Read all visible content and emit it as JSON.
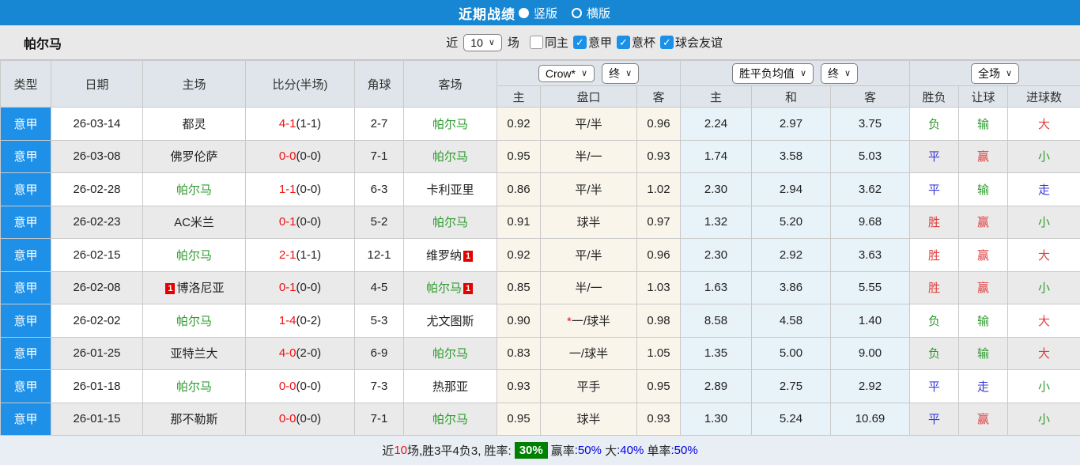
{
  "topbar": {
    "title": "近期战绩",
    "options": [
      {
        "label": "竖版",
        "selected": true
      },
      {
        "label": "横版",
        "selected": false
      }
    ]
  },
  "filterbar": {
    "team": "帕尔马",
    "recent_label": "近",
    "recent_value": "10",
    "unit_label": "场",
    "checkboxes": [
      {
        "label": "同主",
        "checked": false
      },
      {
        "label": "意甲",
        "checked": true
      },
      {
        "label": "意杯",
        "checked": true
      },
      {
        "label": "球会友谊",
        "checked": true
      }
    ]
  },
  "table": {
    "columns": [
      "类型",
      "日期",
      "主场",
      "比分(半场)",
      "角球",
      "客场"
    ],
    "odds_groups": [
      {
        "selects": [
          "Crow*",
          "终"
        ],
        "sub": [
          "主",
          "盘口",
          "客"
        ]
      },
      {
        "selects": [
          "胜平负均值",
          "终"
        ],
        "sub": [
          "主",
          "和",
          "客"
        ]
      },
      {
        "selects": [
          "全场"
        ],
        "sub": [
          "胜负",
          "让球",
          "进球数"
        ]
      }
    ],
    "rows": [
      {
        "type": "意甲",
        "date": "26-03-14",
        "home": {
          "name": "都灵"
        },
        "score": "4-1",
        "half": "(1-1)",
        "corner": "2-7",
        "away": {
          "name": "帕尔马",
          "green": true
        },
        "odds": [
          "0.92",
          "平/半",
          "0.96"
        ],
        "avg": [
          "2.24",
          "2.97",
          "3.75"
        ],
        "results": [
          {
            "t": "负",
            "c": "green"
          },
          {
            "t": "输",
            "c": "green"
          },
          {
            "t": "大",
            "c": "red"
          }
        ]
      },
      {
        "type": "意甲",
        "date": "26-03-08",
        "home": {
          "name": "佛罗伦萨"
        },
        "score": "0-0",
        "half": "(0-0)",
        "corner": "7-1",
        "away": {
          "name": "帕尔马",
          "green": true
        },
        "odds": [
          "0.95",
          "半/一",
          "0.93"
        ],
        "avg": [
          "1.74",
          "3.58",
          "5.03"
        ],
        "results": [
          {
            "t": "平",
            "c": "blue"
          },
          {
            "t": "赢",
            "c": "red"
          },
          {
            "t": "小",
            "c": "green"
          }
        ]
      },
      {
        "type": "意甲",
        "date": "26-02-28",
        "home": {
          "name": "帕尔马",
          "green": true
        },
        "score": "1-1",
        "half": "(0-0)",
        "corner": "6-3",
        "away": {
          "name": "卡利亚里"
        },
        "odds": [
          "0.86",
          "平/半",
          "1.02"
        ],
        "avg": [
          "2.30",
          "2.94",
          "3.62"
        ],
        "results": [
          {
            "t": "平",
            "c": "blue"
          },
          {
            "t": "输",
            "c": "green"
          },
          {
            "t": "走",
            "c": "blue"
          }
        ]
      },
      {
        "type": "意甲",
        "date": "26-02-23",
        "home": {
          "name": "AC米兰"
        },
        "score": "0-1",
        "half": "(0-0)",
        "corner": "5-2",
        "away": {
          "name": "帕尔马",
          "green": true
        },
        "odds": [
          "0.91",
          "球半",
          "0.97"
        ],
        "avg": [
          "1.32",
          "5.20",
          "9.68"
        ],
        "results": [
          {
            "t": "胜",
            "c": "red"
          },
          {
            "t": "赢",
            "c": "red"
          },
          {
            "t": "小",
            "c": "green"
          }
        ]
      },
      {
        "type": "意甲",
        "date": "26-02-15",
        "home": {
          "name": "帕尔马",
          "green": true
        },
        "score": "2-1",
        "half": "(1-1)",
        "corner": "12-1",
        "away": {
          "name": "维罗纳",
          "card": "1"
        },
        "odds": [
          "0.92",
          "平/半",
          "0.96"
        ],
        "avg": [
          "2.30",
          "2.92",
          "3.63"
        ],
        "results": [
          {
            "t": "胜",
            "c": "red"
          },
          {
            "t": "赢",
            "c": "red"
          },
          {
            "t": "大",
            "c": "red"
          }
        ]
      },
      {
        "type": "意甲",
        "date": "26-02-08",
        "home": {
          "name": "博洛尼亚",
          "card": "1",
          "card_pos": "before"
        },
        "score": "0-1",
        "half": "(0-0)",
        "corner": "4-5",
        "away": {
          "name": "帕尔马",
          "green": true,
          "card": "1"
        },
        "odds": [
          "0.85",
          "半/一",
          "1.03"
        ],
        "avg": [
          "1.63",
          "3.86",
          "5.55"
        ],
        "results": [
          {
            "t": "胜",
            "c": "red"
          },
          {
            "t": "赢",
            "c": "red"
          },
          {
            "t": "小",
            "c": "green"
          }
        ]
      },
      {
        "type": "意甲",
        "date": "26-02-02",
        "home": {
          "name": "帕尔马",
          "green": true
        },
        "score": "1-4",
        "half": "(0-2)",
        "corner": "5-3",
        "away": {
          "name": "尤文图斯"
        },
        "odds": [
          "0.90",
          "*一/球半",
          "0.98"
        ],
        "avg": [
          "8.58",
          "4.58",
          "1.40"
        ],
        "results": [
          {
            "t": "负",
            "c": "green"
          },
          {
            "t": "输",
            "c": "green"
          },
          {
            "t": "大",
            "c": "red"
          }
        ]
      },
      {
        "type": "意甲",
        "date": "26-01-25",
        "home": {
          "name": "亚特兰大"
        },
        "score": "4-0",
        "half": "(2-0)",
        "corner": "6-9",
        "away": {
          "name": "帕尔马",
          "green": true
        },
        "odds": [
          "0.83",
          "一/球半",
          "1.05"
        ],
        "avg": [
          "1.35",
          "5.00",
          "9.00"
        ],
        "results": [
          {
            "t": "负",
            "c": "green"
          },
          {
            "t": "输",
            "c": "green"
          },
          {
            "t": "大",
            "c": "red"
          }
        ]
      },
      {
        "type": "意甲",
        "date": "26-01-18",
        "home": {
          "name": "帕尔马",
          "green": true
        },
        "score": "0-0",
        "half": "(0-0)",
        "corner": "7-3",
        "away": {
          "name": "热那亚"
        },
        "odds": [
          "0.93",
          "平手",
          "0.95"
        ],
        "avg": [
          "2.89",
          "2.75",
          "2.92"
        ],
        "results": [
          {
            "t": "平",
            "c": "blue"
          },
          {
            "t": "走",
            "c": "blue"
          },
          {
            "t": "小",
            "c": "green"
          }
        ]
      },
      {
        "type": "意甲",
        "date": "26-01-15",
        "home": {
          "name": "那不勒斯"
        },
        "score": "0-0",
        "half": "(0-0)",
        "corner": "7-1",
        "away": {
          "name": "帕尔马",
          "green": true
        },
        "odds": [
          "0.95",
          "球半",
          "0.93"
        ],
        "avg": [
          "1.30",
          "5.24",
          "10.69"
        ],
        "results": [
          {
            "t": "平",
            "c": "blue"
          },
          {
            "t": "赢",
            "c": "red"
          },
          {
            "t": "小",
            "c": "green"
          }
        ]
      }
    ]
  },
  "footer": {
    "segments": [
      {
        "text": "近",
        "style": "plain"
      },
      {
        "text": "10",
        "style": "red"
      },
      {
        "text": "场,胜3平4负3, 胜率:",
        "style": "plain"
      },
      {
        "text": "30%",
        "style": "badge"
      },
      {
        "text": "赢率",
        "style": "plain"
      },
      {
        "text": ":50%",
        "style": "blue"
      },
      {
        "text": " 大",
        "style": "plain"
      },
      {
        "text": ":40%",
        "style": "blue"
      },
      {
        "text": " 单率",
        "style": "plain"
      },
      {
        "text": ":50%",
        "style": "blue"
      }
    ]
  },
  "colors": {
    "topbar_blue": "#1787d3",
    "accent_blue": "#1b90e8",
    "league_cell_blue": "#1e90e8",
    "team_green": "#2e9b2e",
    "score_red": "#ee1111",
    "result_red": "#e04040",
    "result_green": "#2e9b2e",
    "result_blue": "#3a3ad6",
    "odds_col_cream": "#f9f5eb",
    "avg_col_lightblue": "#e8f2f9",
    "alt_row_grey": "#eaeaea",
    "win_rate_badge_green": "#008000",
    "red_card_badge": "#e60000"
  }
}
